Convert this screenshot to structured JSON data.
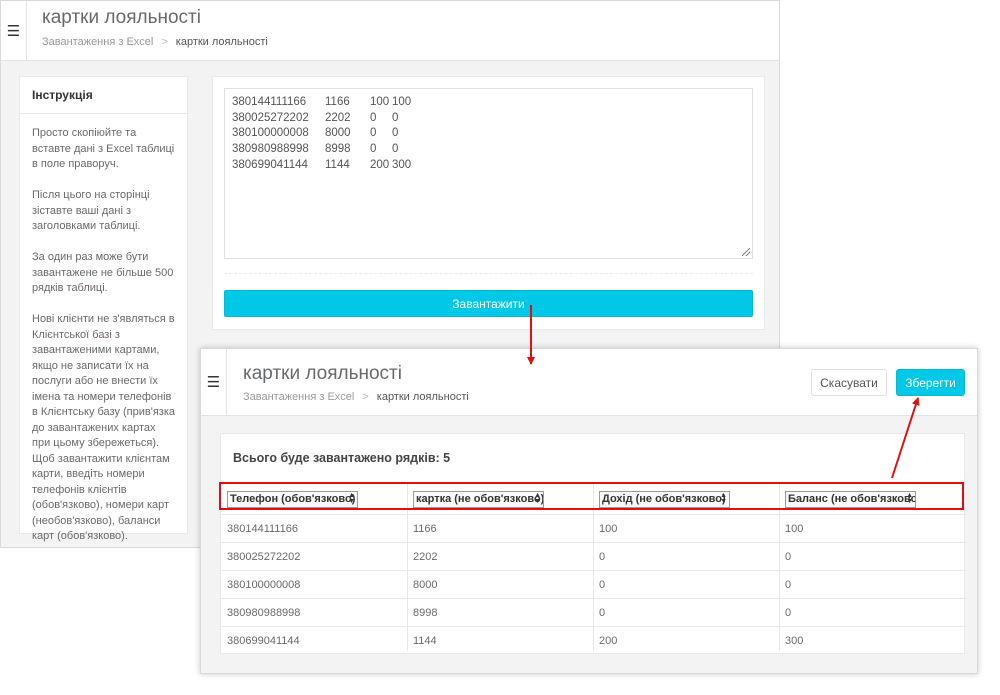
{
  "colors": {
    "accent": "#00c8e6",
    "annotation": "#e01010"
  },
  "back_window": {
    "title": "картки лояльності",
    "breadcrumb": {
      "parent": "Завантаження з Excel",
      "separator": ">",
      "current": "картки лояльності"
    },
    "instructions": {
      "heading": "Інструкція",
      "paragraphs": [
        "Просто скопіюйте та вставте дані з Excel таблиці в поле праворуч.",
        "Після цього на сторінці зіставте ваші дані з заголовками таблиці.",
        "За один раз може бути завантажене не більше 500 рядків таблиці.",
        "Нові клієнти не з'являться в Клієнтської базі з завантаженими картами, якщо не записати їх на послуги або не внести їх імена та номери телефонів в Клієнтську базу (прив'язка до завантажених картах при цьому збережеться). Щоб завантажити клієнтам карти, введіть номери телефонів клієнтів (обов'язково), номери карт (необов'язково), баланси карт (обов'язково)."
      ]
    },
    "textarea_rows": [
      [
        "380144111166",
        "1166",
        "100",
        "100"
      ],
      [
        "380025272202",
        "2202",
        "0",
        "0"
      ],
      [
        "380100000008",
        "8000",
        "0",
        "0"
      ],
      [
        "380980988998",
        "8998",
        "0",
        "0"
      ],
      [
        "380699041144",
        "1144",
        "200",
        "300"
      ]
    ],
    "upload_button": "Завантажити"
  },
  "front_window": {
    "title": "картки лояльності",
    "breadcrumb": {
      "parent": "Завантаження з Excel",
      "separator": ">",
      "current": "картки лояльності"
    },
    "cancel_button": "Скасувати",
    "save_button": "Зберегти",
    "total_label": "Всього буде завантажено рядків: 5",
    "columns": [
      "Телефон (обов'язково)",
      "картка (не обов'язково)",
      "Дохід (не обов'язково)",
      "Баланс (не обов'язково)"
    ],
    "rows": [
      [
        "380144111166",
        "1166",
        "100",
        "100"
      ],
      [
        "380025272202",
        "2202",
        "0",
        "0"
      ],
      [
        "380100000008",
        "8000",
        "0",
        "0"
      ],
      [
        "380980988998",
        "8998",
        "0",
        "0"
      ],
      [
        "380699041144",
        "1144",
        "200",
        "300"
      ]
    ]
  }
}
